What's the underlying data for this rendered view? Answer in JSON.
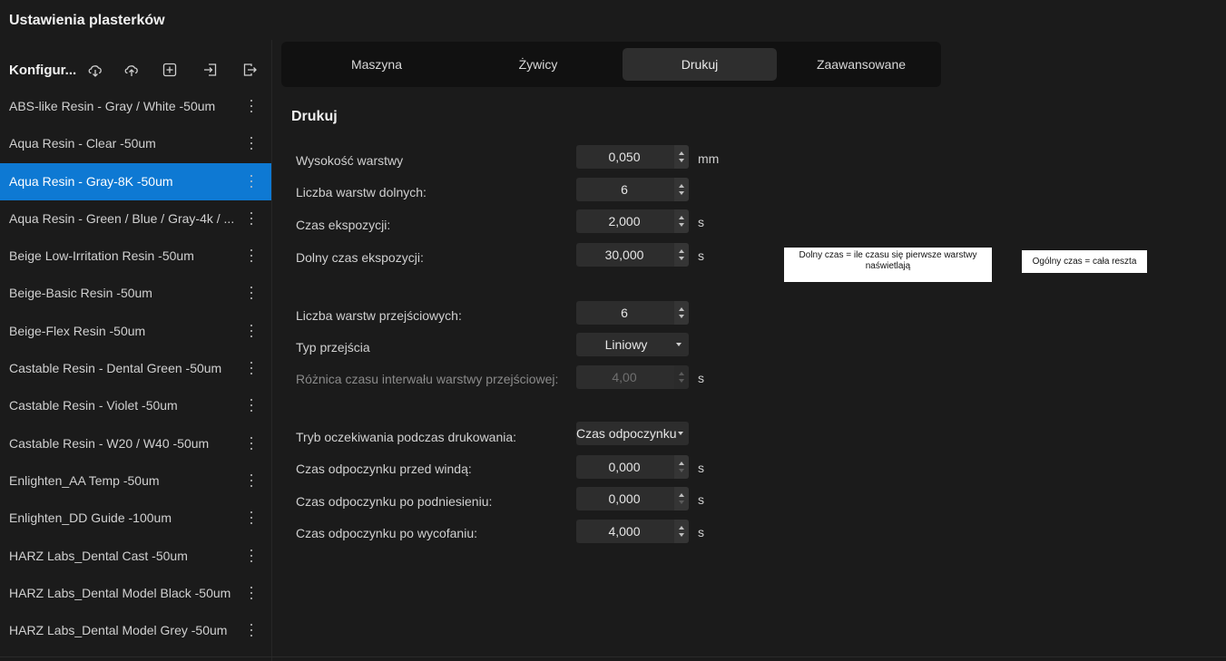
{
  "window": {
    "title": "Ustawienia plasterków"
  },
  "sidebar": {
    "header": "Konfigur...",
    "tools": [
      "cloud-download-icon",
      "cloud-upload-icon",
      "add-box-icon",
      "import-icon",
      "export-icon"
    ],
    "items": [
      {
        "label": "ABS-like Resin - Gray / White -50um"
      },
      {
        "label": "Aqua Resin - Clear -50um"
      },
      {
        "label": "Aqua Resin - Gray-8K -50um",
        "selected": true
      },
      {
        "label": "Aqua Resin - Green / Blue / Gray-4k / ..."
      },
      {
        "label": "Beige Low-Irritation Resin -50um"
      },
      {
        "label": "Beige-Basic Resin -50um"
      },
      {
        "label": "Beige-Flex Resin -50um"
      },
      {
        "label": "Castable Resin - Dental Green -50um"
      },
      {
        "label": "Castable Resin - Violet -50um"
      },
      {
        "label": "Castable Resin - W20 / W40 -50um"
      },
      {
        "label": "Enlighten_AA Temp -50um"
      },
      {
        "label": "Enlighten_DD Guide -100um"
      },
      {
        "label": "HARZ Labs_Dental Cast -50um"
      },
      {
        "label": "HARZ Labs_Dental Model Black -50um"
      },
      {
        "label": "HARZ Labs_Dental Model Grey -50um"
      }
    ],
    "accent_color": "#0e79d3"
  },
  "tabs": [
    {
      "label": "Maszyna"
    },
    {
      "label": "Żywicy"
    },
    {
      "label": "Drukuj",
      "active": true
    },
    {
      "label": "Zaawansowane"
    }
  ],
  "section": {
    "title": "Drukuj"
  },
  "fields": [
    {
      "label": "Wysokość warstwy",
      "value": "0,050",
      "unit": "mm"
    },
    {
      "label": "Liczba warstw dolnych:",
      "value": "6",
      "unit": ""
    },
    {
      "label": "Czas ekspozycji:",
      "value": "2,000",
      "unit": "s"
    },
    {
      "label": "Dolny czas ekspozycji:",
      "value": "30,000",
      "unit": "s"
    },
    {
      "label": "Liczba warstw przejściowych:",
      "value": "6",
      "unit": ""
    },
    {
      "label": "Typ przejścia",
      "value": "Liniowy",
      "unit": ""
    },
    {
      "label": "Różnica czasu interwału warstwy przejściowej:",
      "value": "4,00",
      "unit": "s",
      "disabled": true
    },
    {
      "label": "Tryb oczekiwania podczas drukowania:",
      "value": "Czas odpoczynku",
      "unit": ""
    },
    {
      "label": "Czas odpoczynku przed windą:",
      "value": "0,000",
      "unit": "s"
    },
    {
      "label": "Czas odpoczynku po podniesieniu:",
      "value": "0,000",
      "unit": "s"
    },
    {
      "label": "Czas odpoczynku po wycofaniu:",
      "value": "4,000",
      "unit": "s"
    }
  ],
  "notes": [
    {
      "text": "Dolny czas = ile czasu się pierwsze warstwy naświetlają"
    },
    {
      "text": "Ogólny czas = cała reszta"
    }
  ]
}
